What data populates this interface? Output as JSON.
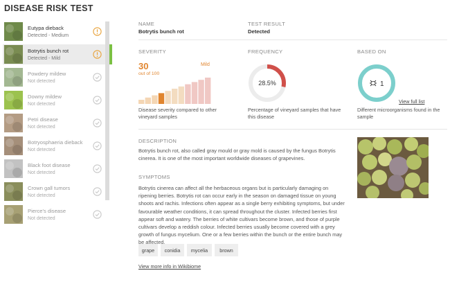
{
  "app_title": "DISEASE RISK TEST",
  "sidebar": {
    "items": [
      {
        "name": "Eutypa dieback",
        "status": "Detected - Medium",
        "icon": "warning-icon",
        "color": "#e8a23a",
        "thumb": "#6f8a4a"
      },
      {
        "name": "Botrytis bunch rot",
        "status": "Detected - Mild",
        "icon": "warning-icon",
        "color": "#e8a23a",
        "thumb": "#7a8c52"
      },
      {
        "name": "Powdery mildew",
        "status": "Not detected",
        "icon": "check-icon",
        "color": "#c8c8c8",
        "thumb": "#a3b892"
      },
      {
        "name": "Downy mildew",
        "status": "Not detected",
        "icon": "check-icon",
        "color": "#c8c8c8",
        "thumb": "#9cc24e"
      },
      {
        "name": "Petri disease",
        "status": "Not detected",
        "icon": "check-icon",
        "color": "#c8c8c8",
        "thumb": "#b49c84"
      },
      {
        "name": "Botryosphaeria dieback",
        "status": "Not detected",
        "icon": "check-icon",
        "color": "#c8c8c8",
        "thumb": "#a58f7a"
      },
      {
        "name": "Black foot disease",
        "status": "Not detected",
        "icon": "check-icon",
        "color": "#c8c8c8",
        "thumb": "#c2c2c2"
      },
      {
        "name": "Crown gall tumors",
        "status": "Not detected",
        "icon": "check-icon",
        "color": "#c8c8c8",
        "thumb": "#8a8e5c"
      },
      {
        "name": "Pierce's disease",
        "status": "Not detected",
        "icon": "check-icon",
        "color": "#c8c8c8",
        "thumb": "#a7a074"
      }
    ]
  },
  "header": {
    "name_label": "NAME",
    "name_value": "Botrytis bunch rot",
    "result_label": "TEST RESULT",
    "result_value": "Detected"
  },
  "severity": {
    "label": "SEVERITY",
    "value": "30",
    "out_of": "out of 100",
    "level": "Mild",
    "level_index": 3,
    "bar_count": 11,
    "caption": "Disease severity compared to other vineyard samples",
    "accent": "#e0852f"
  },
  "frequency": {
    "label": "FREQUENCY",
    "percent_text": "28.5%",
    "percent": 28.5,
    "caption": "Percentage of vineyard samples that have this disease",
    "color": "#d0504a",
    "track": "#ececec"
  },
  "based_on": {
    "label": "BASED ON",
    "count": "1",
    "icon": "microorganism-icon",
    "link": "View full list",
    "caption": "Different microorganisms found in the sample",
    "color": "#7ccfcc"
  },
  "description": {
    "heading": "DESCRIPTION",
    "text": "Botrytis bunch rot, also called gray mould or gray mold is caused by the fungus Botrytis cinerea. It is one of the most important worldwide diseases of grapevines."
  },
  "symptoms": {
    "heading": "SYMPTOMS",
    "text": "Botrytis cinerea can affect all the herbaceous organs but is particularly damaging on ripening berries. Botrytis rot can occur early in the season on damaged tissue on young shoots and rachis. Infections often appear as a single berry exhibiting symptoms, but under favourable weather conditions, it can spread throughout the cluster. Infected berries first appear soft and watery. The berries of white cultivars become brown, and those of purple cultivars develop a reddish colour. Infected berries usually become covered with a grey growth of fungus mycelium. One or a few berries within the bunch or the entire bunch may be affected."
  },
  "tags": [
    "grape",
    "conidia",
    "mycelia",
    "brown"
  ],
  "more_link": "View more info in Wikibiome"
}
